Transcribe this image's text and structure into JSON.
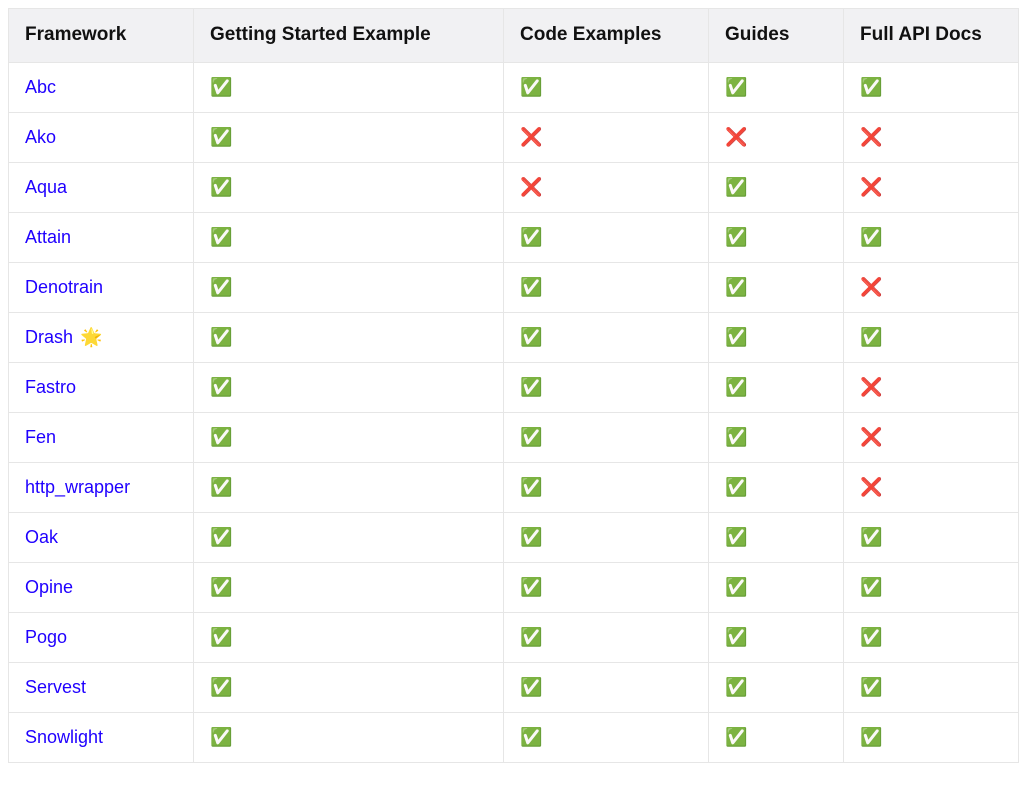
{
  "icons": {
    "yes": "✅",
    "no": "❌",
    "star": "🌟"
  },
  "table": {
    "headers": [
      "Framework",
      "Getting Started Example",
      "Code Examples",
      "Guides",
      "Full API Docs"
    ],
    "rows": [
      {
        "name": "Abc",
        "badge": null,
        "getting_started": "yes",
        "code_examples": "yes",
        "guides": "yes",
        "full_api_docs": "yes"
      },
      {
        "name": "Ako",
        "badge": null,
        "getting_started": "yes",
        "code_examples": "no",
        "guides": "no",
        "full_api_docs": "no"
      },
      {
        "name": "Aqua",
        "badge": null,
        "getting_started": "yes",
        "code_examples": "no",
        "guides": "yes",
        "full_api_docs": "no"
      },
      {
        "name": "Attain",
        "badge": null,
        "getting_started": "yes",
        "code_examples": "yes",
        "guides": "yes",
        "full_api_docs": "yes"
      },
      {
        "name": "Denotrain",
        "badge": null,
        "getting_started": "yes",
        "code_examples": "yes",
        "guides": "yes",
        "full_api_docs": "no"
      },
      {
        "name": "Drash",
        "badge": "star",
        "getting_started": "yes",
        "code_examples": "yes",
        "guides": "yes",
        "full_api_docs": "yes"
      },
      {
        "name": "Fastro",
        "badge": null,
        "getting_started": "yes",
        "code_examples": "yes",
        "guides": "yes",
        "full_api_docs": "no"
      },
      {
        "name": "Fen",
        "badge": null,
        "getting_started": "yes",
        "code_examples": "yes",
        "guides": "yes",
        "full_api_docs": "no"
      },
      {
        "name": "http_wrapper",
        "badge": null,
        "getting_started": "yes",
        "code_examples": "yes",
        "guides": "yes",
        "full_api_docs": "no"
      },
      {
        "name": "Oak",
        "badge": null,
        "getting_started": "yes",
        "code_examples": "yes",
        "guides": "yes",
        "full_api_docs": "yes"
      },
      {
        "name": "Opine",
        "badge": null,
        "getting_started": "yes",
        "code_examples": "yes",
        "guides": "yes",
        "full_api_docs": "yes"
      },
      {
        "name": "Pogo",
        "badge": null,
        "getting_started": "yes",
        "code_examples": "yes",
        "guides": "yes",
        "full_api_docs": "yes"
      },
      {
        "name": "Servest",
        "badge": null,
        "getting_started": "yes",
        "code_examples": "yes",
        "guides": "yes",
        "full_api_docs": "yes"
      },
      {
        "name": "Snowlight",
        "badge": null,
        "getting_started": "yes",
        "code_examples": "yes",
        "guides": "yes",
        "full_api_docs": "yes"
      }
    ]
  }
}
